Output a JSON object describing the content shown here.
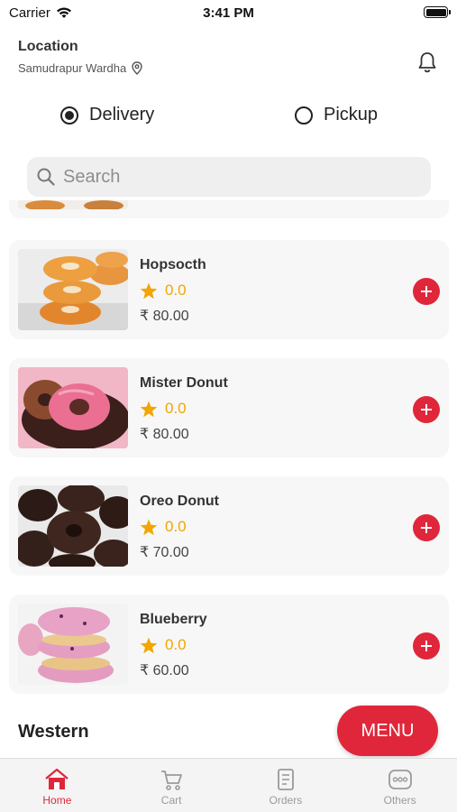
{
  "status_bar": {
    "carrier": "Carrier",
    "time": "3:41 PM"
  },
  "header": {
    "location_label": "Location",
    "location_value": "Samudrapur Wardha"
  },
  "modes": [
    {
      "label": "Delivery",
      "selected": true
    },
    {
      "label": "Pickup",
      "selected": false
    }
  ],
  "search": {
    "placeholder": "Search"
  },
  "items": [
    {
      "name": "Hopsocth",
      "rating": "0.0",
      "price": "₹ 80.00"
    },
    {
      "name": "Mister Donut",
      "rating": "0.0",
      "price": "₹ 80.00"
    },
    {
      "name": "Oreo Donut",
      "rating": "0.0",
      "price": "₹ 70.00"
    },
    {
      "name": "Blueberry",
      "rating": "0.0",
      "price": "₹ 60.00"
    }
  ],
  "section_title": "Western",
  "menu_button": "MENU",
  "tabs": [
    {
      "label": "Home",
      "icon": "home-icon",
      "active": true
    },
    {
      "label": "Cart",
      "icon": "cart-icon",
      "active": false
    },
    {
      "label": "Orders",
      "icon": "orders-icon",
      "active": false
    },
    {
      "label": "Others",
      "icon": "more-icon",
      "active": false
    }
  ],
  "colors": {
    "accent": "#e0263a",
    "star": "#f2a600"
  }
}
